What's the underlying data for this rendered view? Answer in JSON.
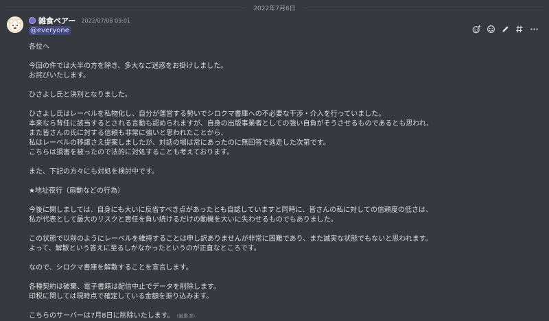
{
  "date_divider": "2022年7月6日",
  "author": {
    "name": "雑食ベアー",
    "timestamp": "2022/07/08 09:01"
  },
  "mention": "@everyone",
  "edited": "(編集済)",
  "lines": [
    "各位へ",
    "",
    "今回の件では大半の方を除き、多大なご迷惑をお掛けしました。",
    "お詫びいたします。",
    "",
    "ひさよし氏と決別となりました。",
    "",
    "ひさよし氏はレーベルを私物化し、自分が運営する勢いでシロクマ書庫への不必要な干渉・介入を行っていました。",
    "本来なら背任に該当するとされる言動も認められますが、自身の出版事業者としての強い自負がそうさせるものであるとも思われ、",
    "また皆さんの氏に対する信頼も非常に強いと思われたことから、",
    "私はレーベルの移譲さえ提案しましたが、対話の場は常にあったのに無回答で逃走した次第です。",
    "こちらは損害を被ったので法的に対処することも考えております。",
    "",
    "また、下記の方々にも対処を検討中です。",
    "",
    "★地址夜行（扇動などの行為）",
    "",
    "今後に関しましては、自身にも大いに反省すべき点があったとも自認していますと同時に、皆さんの私に対しての信頼度の低さは、",
    "私が代表として最大のリスクと責任を負い続けるだけの動機を大いに失わせるものでもありました。",
    "",
    "この状態で以前のようにレーベルを維持することは申し訳ありませんが非常に困難であり、また誠実な状態でもないと思われます。",
    "よって、解散という答えに至るしかなかったというのが正直なところです。",
    "",
    "なので、シロクマ書庫を解散することを宣言します。",
    "",
    "各種契約は破棄、電子書籍は配信中止でデータを削除します。",
    "印税に関しては現時点で確定している金額を振り込みます。",
    "",
    "こちらのサーバーは7月8日に削除いたします。"
  ],
  "toolbar_icons": [
    "add-reaction-icon",
    "reply-icon",
    "edit-icon",
    "thread-icon",
    "more-icon"
  ]
}
